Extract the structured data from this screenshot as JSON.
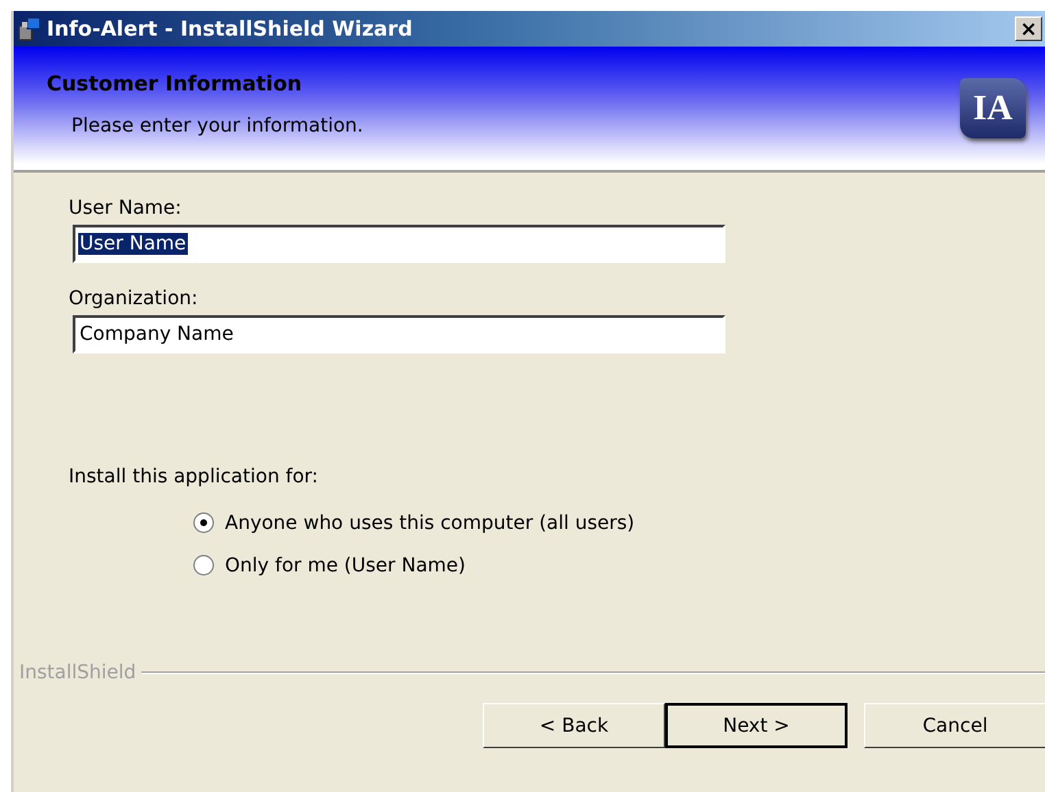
{
  "window": {
    "title": "Info-Alert - InstallShield Wizard",
    "close": "×"
  },
  "header": {
    "title": "Customer Information",
    "subtitle": "Please enter your information.",
    "logo": "IA"
  },
  "fields": [
    {
      "label": "User Name:",
      "value": "User Name",
      "text_selected": true
    },
    {
      "label": "Organization:",
      "value": "Company Name",
      "text_selected": false
    }
  ],
  "install_for": {
    "label": "Install this application for:",
    "options": [
      {
        "label": "Anyone who uses this computer (all users)",
        "selected": true
      },
      {
        "label": "Only for me (User Name)",
        "selected": false
      }
    ]
  },
  "brand": "InstallShield",
  "buttons": [
    {
      "label": "< Back",
      "default": false
    },
    {
      "label": "Next >",
      "default": true
    },
    {
      "label": "Cancel",
      "default": false
    }
  ]
}
